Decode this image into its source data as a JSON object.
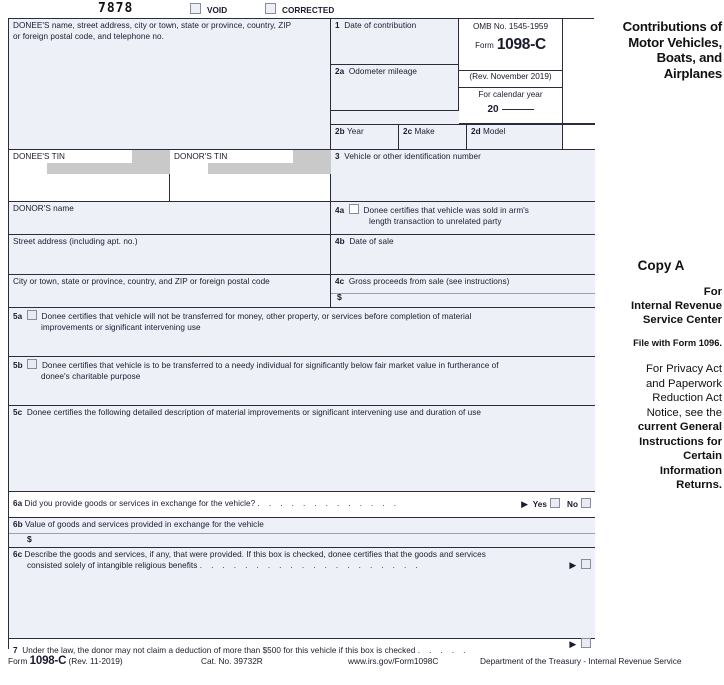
{
  "topbar": {
    "form_number": "7878",
    "void_label": "VOID",
    "corrected_label": "CORRECTED"
  },
  "header": {
    "donee_block_line1": "DONEE'S name, street address, city or town, state or province, country, ZIP",
    "donee_block_line2": "or foreign postal code, and telephone no.",
    "box1_num": "1",
    "box1_label": "Date of contribution",
    "box2a_num": "2a",
    "box2a_label": "Odometer mileage",
    "omb": "OMB No. 1545-1959",
    "form_word": "Form",
    "form_name": "1098-C",
    "revision": "(Rev. November 2019)",
    "calendar_year_label": "For calendar year",
    "calendar_year_prefix": "20",
    "box2b_num": "2b",
    "box2b_label": "Year",
    "box2c_num": "2c",
    "box2c_label": "Make",
    "box2d_num": "2d",
    "box2d_label": "Model",
    "title_line1": "Contributions of",
    "title_line2": "Motor Vehicles,",
    "title_line3": "Boats, and",
    "title_line4": "Airplanes"
  },
  "body": {
    "donee_tin_label": "DONEE'S TIN",
    "donor_tin_label": "DONOR'S TIN",
    "box3_num": "3",
    "box3_label": "Vehicle or other identification number",
    "donor_name_label": "DONOR'S name",
    "box4a_num": "4a",
    "box4a_line1": "Donee certifies that vehicle was sold in arm's",
    "box4a_line2": "length transaction to unrelated party",
    "street_label": "Street address (including apt. no.)",
    "box4b_num": "4b",
    "box4b_label": "Date of sale",
    "city_label": "City or town, state or province, country, and ZIP or foreign postal code",
    "box4c_num": "4c",
    "box4c_label": "Gross proceeds from sale (see instructions)",
    "dollar_sign": "$",
    "box5a_num": "5a",
    "box5a_line1": "Donee certifies that vehicle will not be transferred for money, other property, or services before completion of material",
    "box5a_line2": "improvements or significant intervening use",
    "box5b_num": "5b",
    "box5b_line1": "Donee certifies that vehicle is to be transferred to a needy individual for significantly below fair market value in furtherance of",
    "box5b_line2": "donee's charitable purpose",
    "box5c_num": "5c",
    "box5c_label": "Donee certifies the following detailed description of material improvements or significant intervening use and duration of use",
    "box6a_num": "6a",
    "box6a_label": "Did you provide goods or services in exchange for the vehicle?",
    "box6a_dots": ".   .   .   .   .   .   .   .   .   .   .   .   .",
    "box6a_arrow": "▶",
    "box6a_yes": "Yes",
    "box6a_no": "No",
    "box6b_num": "6b",
    "box6b_label": "Value of goods and services provided in exchange for the vehicle",
    "box6c_num": "6c",
    "box6c_line1": "Describe the goods and services, if any, that were provided. If this box is checked, donee certifies that the goods and services",
    "box6c_line2": "consisted solely of intangible religious benefits",
    "box6c_dots": ".   .   .   .   .   .   .   .   .   .   .   .   .   .   .   .   .   .   .   .",
    "box6c_arrow": "▶",
    "box7_num": "7",
    "box7_label": "Under the law, the donor may not claim a deduction of more than $500 for this vehicle if this box is checked",
    "box7_dots": ".   .   .   .   .",
    "box7_arrow": "▶"
  },
  "copy": {
    "copy_a": "Copy A",
    "for": "For",
    "irs_line1": "Internal Revenue",
    "irs_line2": "Service Center",
    "file_with": "File with Form 1096.",
    "privacy_line1": "For Privacy Act",
    "privacy_line2": "and Paperwork",
    "privacy_line3": "Reduction Act",
    "privacy_line4": "Notice, see the",
    "privacy_bold1": "current General",
    "privacy_bold2": "Instructions for",
    "privacy_bold3": "Certain",
    "privacy_bold4": "Information",
    "privacy_bold5": "Returns."
  },
  "footer": {
    "form_word": "Form",
    "form_name": "1098-C",
    "revision": "(Rev. 11-2019)",
    "cat_no": "Cat. No. 39732R",
    "url": "www.irs.gov/Form1098C",
    "dept": "Department of the Treasury - Internal Revenue Service"
  },
  "colors": {
    "field_bg": "#eef0f8",
    "border": "#2b2b3d",
    "redaction": "#c9c9c9"
  }
}
